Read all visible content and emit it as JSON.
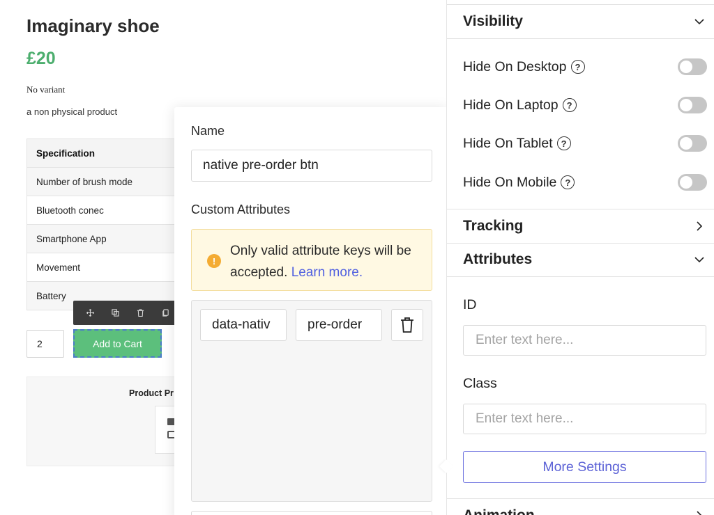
{
  "canvas": {
    "product_title": "Imaginary shoe",
    "price": "£20",
    "variant": "No variant",
    "description": "a non physical product",
    "spec_header": "Specification",
    "spec_rows": [
      "Number of brush mode",
      "Bluetooth conec",
      "Smartphone App",
      "Movement",
      "Battery"
    ],
    "quantity": "2",
    "add_to_cart": "Add to Cart",
    "product_block_label": "Product Pr",
    "toolbar_icons": [
      "move-icon",
      "duplicate-icon",
      "delete-icon",
      "copy-icon"
    ]
  },
  "popover": {
    "name_label": "Name",
    "name_value": "native pre-order btn",
    "custom_attributes_label": "Custom Attributes",
    "notice_text": "Only valid attribute keys will be accepted.",
    "notice_link": "Learn more.",
    "attr_key": "data-nativ",
    "attr_value": "pre-order"
  },
  "panel": {
    "visibility_title": "Visibility",
    "toggles": [
      {
        "label": "Hide On Desktop",
        "on": false
      },
      {
        "label": "Hide On Laptop",
        "on": false
      },
      {
        "label": "Hide On Tablet",
        "on": false
      },
      {
        "label": "Hide On Mobile",
        "on": false
      }
    ],
    "tracking_title": "Tracking",
    "attributes_title": "Attributes",
    "id_label": "ID",
    "id_placeholder": "Enter text here...",
    "class_label": "Class",
    "class_placeholder": "Enter text here...",
    "more_settings": "More Settings",
    "animation_title": "Animation"
  },
  "colors": {
    "price_green": "#4cae6e",
    "button_green": "#5cbf7c",
    "link_blue": "#4f5fe0",
    "accent_indigo": "#5c62d6",
    "notice_bg": "#fff9e3",
    "warning_orange": "#f4ac33"
  }
}
